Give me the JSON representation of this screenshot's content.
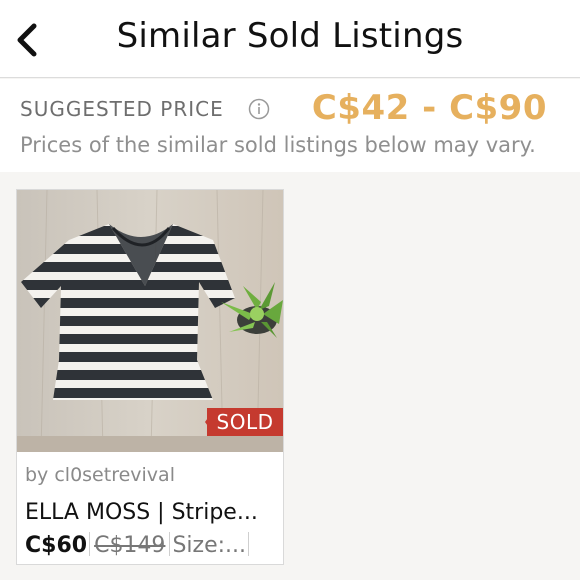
{
  "header": {
    "title": "Similar Sold Listings",
    "back_icon": "chevron-left-icon"
  },
  "suggested": {
    "label": "SUGGESTED PRICE",
    "info_icon": "info-icon",
    "range": "C$42 - C$90",
    "note": "Prices of the similar sold listings below may vary.",
    "accent_color": "#e6b05e"
  },
  "listings": [
    {
      "badge": "SOLD",
      "seller": "by cl0setrevival",
      "title": "ELLA MOSS | Stripe...",
      "price": "C$60",
      "original_price": "C$149",
      "size": "Size:...",
      "badge_color": "#c53a2f"
    }
  ]
}
